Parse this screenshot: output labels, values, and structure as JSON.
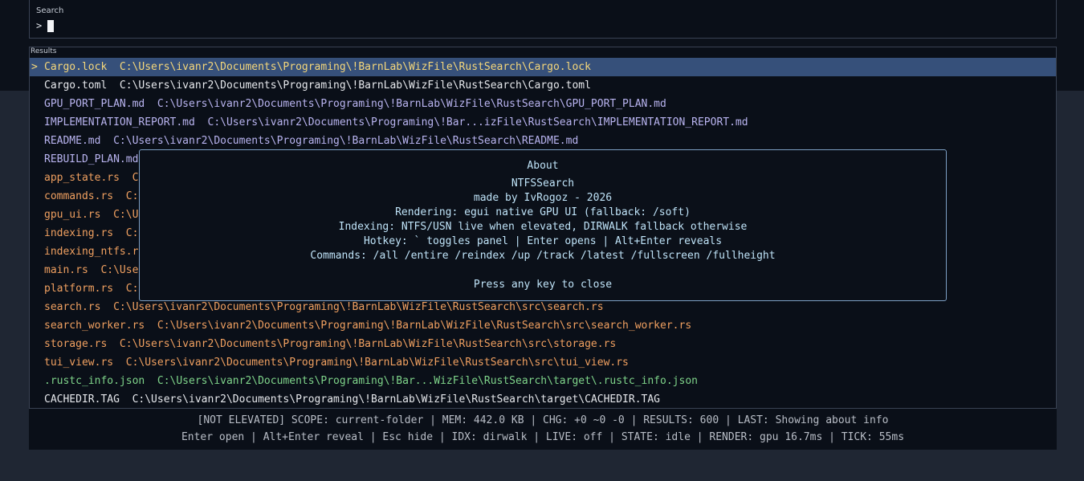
{
  "search": {
    "label": "Search",
    "prompt": ">",
    "value": ""
  },
  "results": {
    "label": "Results",
    "selected_marker": ">",
    "rows": [
      {
        "text": "Cargo.lock  C:\\Users\\ivanr2\\Documents\\Programing\\!BarnLab\\WizFile\\RustSearch\\Cargo.lock",
        "color": "#f5d77a",
        "selected": true
      },
      {
        "text": "Cargo.toml  C:\\Users\\ivanr2\\Documents\\Programing\\!BarnLab\\WizFile\\RustSearch\\Cargo.toml",
        "color": "#e6e8ec",
        "selected": false
      },
      {
        "text": "GPU_PORT_PLAN.md  C:\\Users\\ivanr2\\Documents\\Programing\\!BarnLab\\WizFile\\RustSearch\\GPU_PORT_PLAN.md",
        "color": "#b9b4f0",
        "selected": false
      },
      {
        "text": "IMPLEMENTATION_REPORT.md  C:\\Users\\ivanr2\\Documents\\Programing\\!Bar...izFile\\RustSearch\\IMPLEMENTATION_REPORT.md",
        "color": "#b9b4f0",
        "selected": false
      },
      {
        "text": "README.md  C:\\Users\\ivanr2\\Documents\\Programing\\!BarnLab\\WizFile\\RustSearch\\README.md",
        "color": "#b9b4f0",
        "selected": false
      },
      {
        "text": "REBUILD_PLAN.md",
        "color": "#b9b4f0",
        "selected": false
      },
      {
        "text": "app_state.rs  C",
        "color": "#f0a060",
        "selected": false
      },
      {
        "text": "commands.rs  C:",
        "color": "#f0a060",
        "selected": false
      },
      {
        "text": "gpu_ui.rs  C:\\U",
        "color": "#f0a060",
        "selected": false
      },
      {
        "text": "indexing.rs  C:",
        "color": "#f0a060",
        "selected": false
      },
      {
        "text": "indexing_ntfs.r",
        "color": "#f0a060",
        "selected": false
      },
      {
        "text": "main.rs  C:\\Use",
        "color": "#f0a060",
        "selected": false
      },
      {
        "text": "platform.rs  C:",
        "color": "#f0a060",
        "selected": false
      },
      {
        "text": "search.rs  C:\\Users\\ivanr2\\Documents\\Programing\\!BarnLab\\WizFile\\RustSearch\\src\\search.rs",
        "color": "#f0a060",
        "selected": false
      },
      {
        "text": "search_worker.rs  C:\\Users\\ivanr2\\Documents\\Programing\\!BarnLab\\WizFile\\RustSearch\\src\\search_worker.rs",
        "color": "#f0a060",
        "selected": false
      },
      {
        "text": "storage.rs  C:\\Users\\ivanr2\\Documents\\Programing\\!BarnLab\\WizFile\\RustSearch\\src\\storage.rs",
        "color": "#f0a060",
        "selected": false
      },
      {
        "text": "tui_view.rs  C:\\Users\\ivanr2\\Documents\\Programing\\!BarnLab\\WizFile\\RustSearch\\src\\tui_view.rs",
        "color": "#f0a060",
        "selected": false
      },
      {
        "text": ".rustc_info.json  C:\\Users\\ivanr2\\Documents\\Programing\\!Bar...WizFile\\RustSearch\\target\\.rustc_info.json",
        "color": "#7fd48a",
        "selected": false
      },
      {
        "text": "CACHEDIR.TAG  C:\\Users\\ivanr2\\Documents\\Programing\\!BarnLab\\WizFile\\RustSearch\\target\\CACHEDIR.TAG",
        "color": "#e6e8ec",
        "selected": false
      }
    ]
  },
  "about": {
    "title": "About",
    "app_name": "NTFSSearch",
    "author": "made by IvRogoz - 2026",
    "rendering": "Rendering: egui native GPU UI (fallback: /soft)",
    "indexing": "Indexing: NTFS/USN live when elevated, DIRWALK fallback otherwise",
    "hotkey": "Hotkey: ` toggles panel | Enter opens | Alt+Enter reveals",
    "commands": "Commands: /all /entire /reindex /up /track /latest /fullscreen /fullheight",
    "close_hint": "Press any key to close"
  },
  "status": {
    "line1": "[NOT ELEVATED] SCOPE: current-folder | MEM: 442.0 KB | CHG: +0 ~0 -0 | RESULTS: 600 | LAST: Showing about info",
    "line2": "Enter open | Alt+Enter reveal | Esc hide | IDX: dirwalk | LIVE: off | STATE: idle | RENDER: gpu 16.7ms | TICK: 55ms"
  }
}
